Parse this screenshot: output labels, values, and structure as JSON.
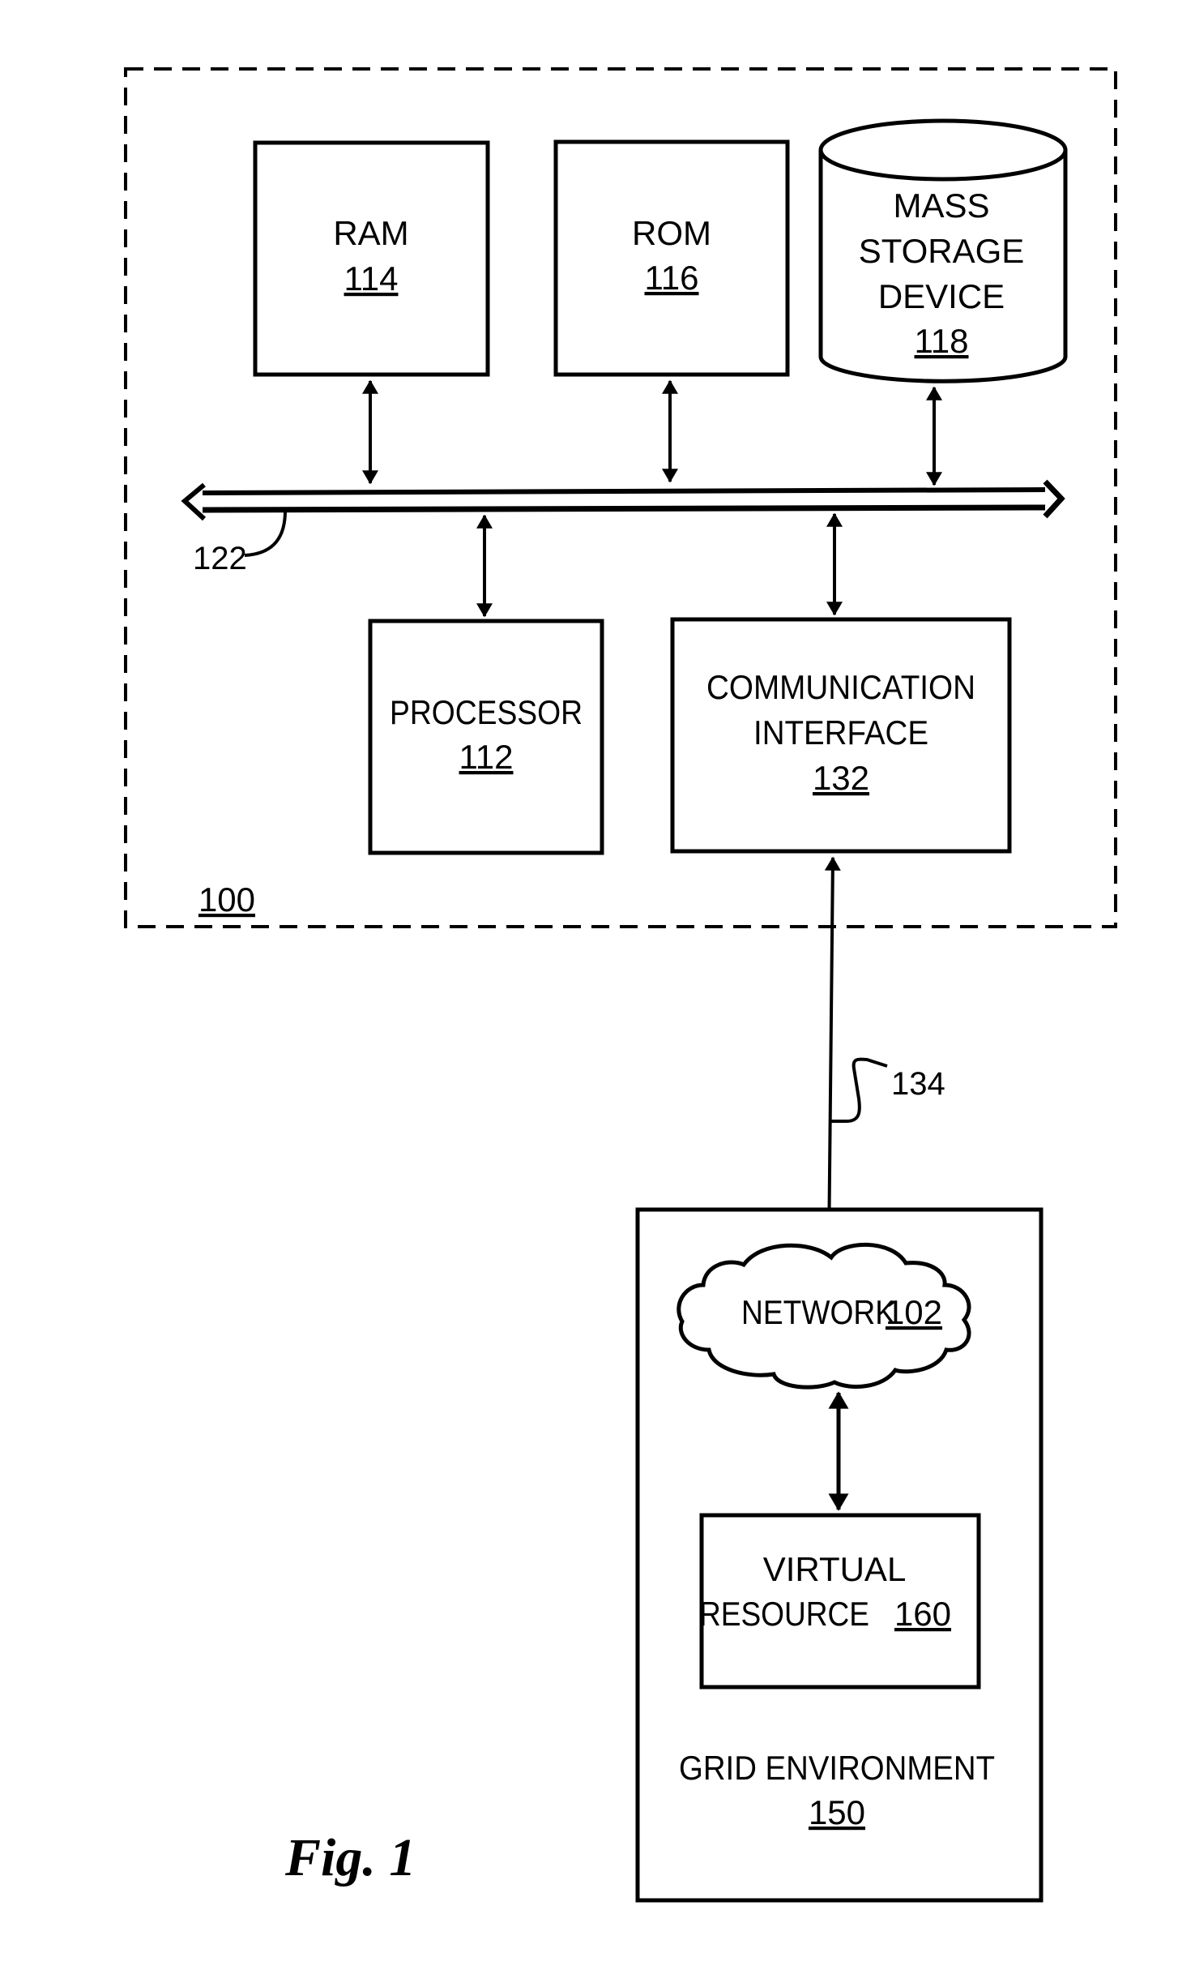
{
  "figure": {
    "caption": "Fig. 1",
    "system": {
      "ref": "100"
    },
    "bus": {
      "ref": "122"
    },
    "link": {
      "ref": "134"
    },
    "components": {
      "ram": {
        "lines": [
          "RAM"
        ],
        "ref": "114"
      },
      "rom": {
        "lines": [
          "ROM"
        ],
        "ref": "116"
      },
      "mass_storage": {
        "lines": [
          "MASS",
          "STORAGE",
          "DEVICE"
        ],
        "ref": "118"
      },
      "processor": {
        "lines": [
          "PROCESSOR"
        ],
        "ref": "112"
      },
      "comm_interface": {
        "lines": [
          "COMMUNICATION",
          "INTERFACE"
        ],
        "ref": "132"
      },
      "network": {
        "label": "NETWORK",
        "ref": "102"
      },
      "virtual_resource": {
        "line1": "VIRTUAL",
        "line2": "RESOURCE",
        "ref": "160"
      },
      "grid_environment": {
        "label": "GRID ENVIRONMENT",
        "ref": "150"
      }
    },
    "colors": {
      "ink": "#000000",
      "paper": "#ffffff"
    }
  }
}
